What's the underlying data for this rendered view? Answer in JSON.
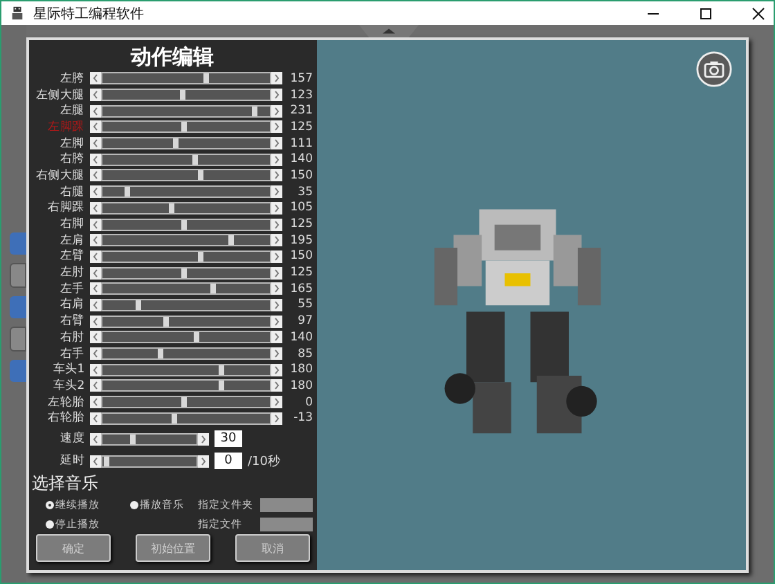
{
  "window": {
    "title": "星际特工编程软件"
  },
  "dialog": {
    "title": "动作编辑",
    "joints": [
      {
        "name": "左胯",
        "level": 0.62,
        "value": "157",
        "selected": false
      },
      {
        "name": "左侧大腿",
        "level": 0.48,
        "value": "123",
        "selected": false
      },
      {
        "name": "左腿",
        "level": 0.91,
        "value": "231",
        "selected": false
      },
      {
        "name": "左脚踝",
        "level": 0.49,
        "value": "125",
        "selected": true
      },
      {
        "name": "左脚",
        "level": 0.44,
        "value": "111",
        "selected": false
      },
      {
        "name": "右胯",
        "level": 0.55,
        "value": "140",
        "selected": false
      },
      {
        "name": "右侧大腿",
        "level": 0.59,
        "value": "150",
        "selected": false
      },
      {
        "name": "右腿",
        "level": 0.15,
        "value": "35",
        "selected": false
      },
      {
        "name": "右脚踝",
        "level": 0.41,
        "value": "105",
        "selected": false
      },
      {
        "name": "右脚",
        "level": 0.49,
        "value": "125",
        "selected": false
      },
      {
        "name": "左肩",
        "level": 0.77,
        "value": "195",
        "selected": false
      },
      {
        "name": "左臂",
        "level": 0.59,
        "value": "150",
        "selected": false
      },
      {
        "name": "左肘",
        "level": 0.49,
        "value": "125",
        "selected": false
      },
      {
        "name": "左手",
        "level": 0.66,
        "value": "165",
        "selected": false
      },
      {
        "name": "右肩",
        "level": 0.22,
        "value": "55",
        "selected": false
      },
      {
        "name": "右臂",
        "level": 0.38,
        "value": "97",
        "selected": false
      },
      {
        "name": "右肘",
        "level": 0.56,
        "value": "140",
        "selected": false
      },
      {
        "name": "右手",
        "level": 0.35,
        "value": "85",
        "selected": false
      },
      {
        "name": "车头1",
        "level": 0.71,
        "value": "180",
        "selected": false
      },
      {
        "name": "车头2",
        "level": 0.71,
        "value": "180",
        "selected": false
      },
      {
        "name": "左轮胎",
        "level": 0.49,
        "value": "0",
        "selected": false
      },
      {
        "name": "右轮胎",
        "level": 0.43,
        "value": "-13",
        "selected": false
      }
    ],
    "speed": {
      "label": "速度",
      "level": 0.32,
      "value": "30"
    },
    "delay": {
      "label": "延时",
      "level": 0.05,
      "value": "0",
      "unit": "/10秒"
    },
    "music": {
      "heading": "选择音乐",
      "options": [
        {
          "label": "继续播放",
          "selected": true
        },
        {
          "label": "播放音乐",
          "selected": false
        },
        {
          "label": "停止播放",
          "selected": false
        }
      ],
      "folder_label": "指定文件夹",
      "file_label": "指定文件"
    },
    "buttons": [
      {
        "label": "确定",
        "disabled": true
      },
      {
        "label": "初始位置",
        "disabled": true
      },
      {
        "label": "取消",
        "disabled": true
      }
    ]
  }
}
